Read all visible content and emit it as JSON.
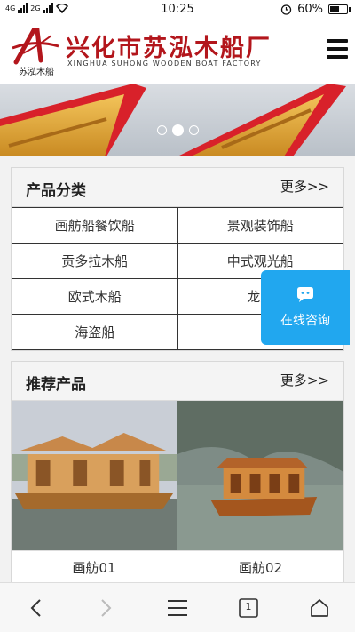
{
  "status_bar": {
    "network": "4G",
    "network2": "2G",
    "time": "10:25",
    "battery": "60%",
    "battery_fraction": 0.6
  },
  "header": {
    "logo_sub": "苏泓木船",
    "brand_cn": "兴化市苏泓木船厂",
    "brand_en": "XINGHUA SUHONG WOODEN BOAT FACTORY",
    "menu_icon": "hamburger-menu-icon"
  },
  "banner": {
    "slide_count": 3,
    "active_slide": 2
  },
  "categories": {
    "title": "产品分类",
    "more": "更多>>",
    "items": [
      {
        "label": "画舫船餐饮船"
      },
      {
        "label": "景观装饰船"
      },
      {
        "label": "贡多拉木船"
      },
      {
        "label": "中式观光船"
      },
      {
        "label": "欧式木船"
      },
      {
        "label": "龙舟"
      },
      {
        "label": "海盗船"
      },
      {
        "label": ""
      }
    ]
  },
  "featured": {
    "title": "推荐产品",
    "more": "更多>>",
    "items": [
      {
        "name": "画舫01"
      },
      {
        "name": "画舫02"
      }
    ]
  },
  "float_consult": {
    "label": "在线咨询",
    "icon": "chat-bubble-icon"
  },
  "bottom_nav": {
    "tab_count": "1",
    "icons": [
      "back-icon",
      "forward-icon",
      "menu-icon",
      "tabs-icon",
      "home-icon"
    ]
  },
  "colors": {
    "brand_red": "#b3161c",
    "consult_blue": "#21a7ef"
  }
}
